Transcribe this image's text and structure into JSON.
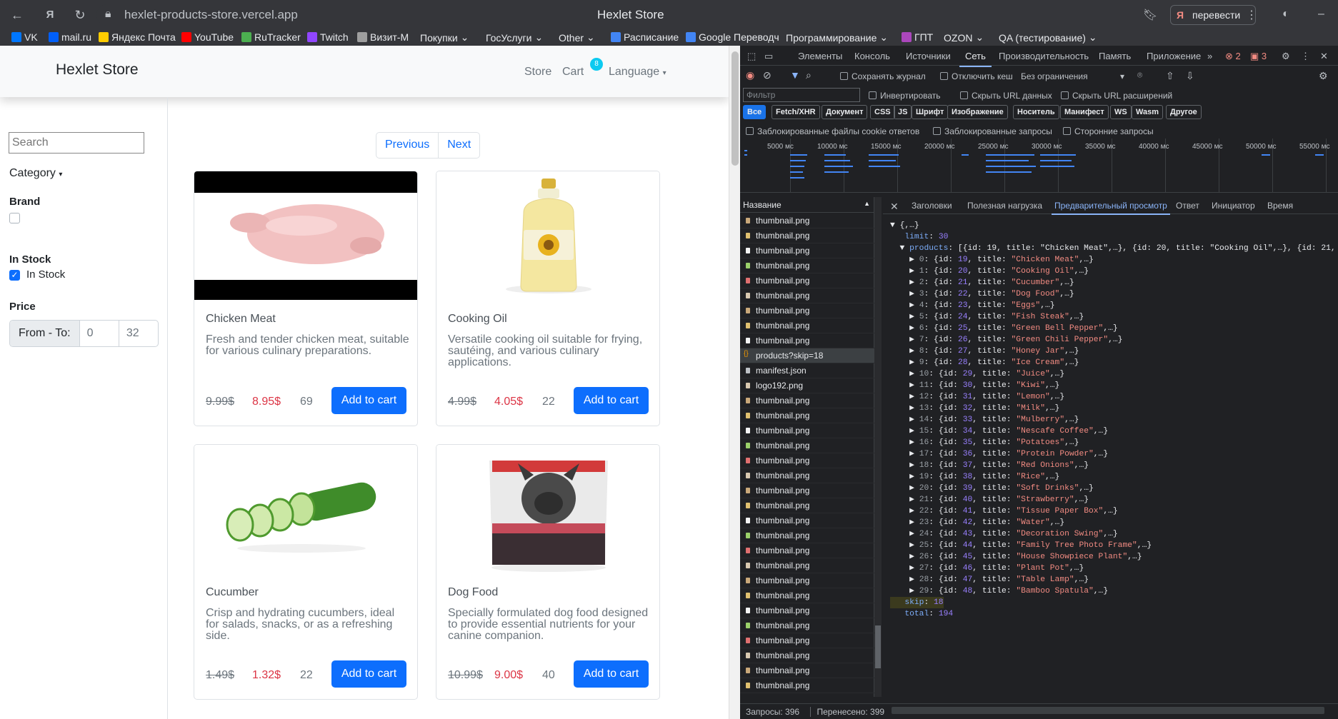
{
  "browser": {
    "url": "hexlet-products-store.vercel.app",
    "window_title": "Hexlet Store",
    "translate_label": "перевести"
  },
  "bookmarks": [
    {
      "label": "VK",
      "color": "#0077ff"
    },
    {
      "label": "mail.ru",
      "color": "#005ff9"
    },
    {
      "label": "Яндекс Почта",
      "color": "#ffcc00"
    },
    {
      "label": "YouTube",
      "color": "#ff0000"
    },
    {
      "label": "RuTracker",
      "color": "#4caf50"
    },
    {
      "label": "Twitch",
      "color": "#9146ff"
    },
    {
      "label": "Визит-М",
      "color": "#9e9e9e"
    },
    {
      "label": "Покупки",
      "color": "#fbbc04"
    },
    {
      "label": "ГосУслуги",
      "color": "#fbbc04"
    },
    {
      "label": "Other",
      "color": "#fbbc04"
    },
    {
      "label": "Расписание",
      "color": "#4285f4"
    },
    {
      "label": "Google Переводч",
      "color": "#4285f4"
    },
    {
      "label": "Программирование",
      "color": "#fbbc04"
    },
    {
      "label": "ГПТ",
      "color": "#ab47bc"
    },
    {
      "label": "OZON",
      "color": "#fbbc04"
    },
    {
      "label": "QA (тестирование)",
      "color": "#fbbc04"
    }
  ],
  "store": {
    "brand": "Hexlet Store",
    "nav_store": "Store",
    "nav_cart": "Cart",
    "cart_count": "8",
    "nav_language": "Language",
    "search_placeholder": "Search",
    "category_label": "Category",
    "brand_label": "Brand",
    "in_stock_heading": "In Stock",
    "in_stock_checkbox": "In Stock",
    "in_stock_checked": true,
    "price_label": "Price",
    "price_addon": "From - To:",
    "price_from": "0",
    "price_to": "32",
    "prev_label": "Previous",
    "next_label": "Next",
    "add_to_cart_label": "Add to cart",
    "products": [
      {
        "title": "Chicken Meat",
        "description": "Fresh and tender chicken meat, suitable for various culinary preparations.",
        "old_price": "9.99$",
        "price": "8.95$",
        "stock": "69"
      },
      {
        "title": "Cooking Oil",
        "description": "Versatile cooking oil suitable for frying, sautéing, and various culinary applications.",
        "old_price": "4.99$",
        "price": "4.05$",
        "stock": "22"
      },
      {
        "title": "Cucumber",
        "description": "Crisp and hydrating cucumbers, ideal for salads, snacks, or as a refreshing side.",
        "old_price": "1.49$",
        "price": "1.32$",
        "stock": "22"
      },
      {
        "title": "Dog Food",
        "description": "Specially formulated dog food designed to provide essential nutrients for your canine companion.",
        "old_price": "10.99$",
        "price": "9.00$",
        "stock": "40"
      }
    ]
  },
  "devtools": {
    "tabs": [
      "Элементы",
      "Консоль",
      "Источники",
      "Сеть",
      "Производительность",
      "Память",
      "Приложение"
    ],
    "active_tab": "Сеть",
    "errors": "2",
    "warnings": "3",
    "preserve_log": "Сохранять журнал",
    "disable_cache": "Отключить кеш",
    "throttle": "Без ограничения",
    "filter_placeholder": "Фильтр",
    "invert": "Инвертировать",
    "hide_data_urls": "Скрыть URL данных",
    "hide_ext_urls": "Скрыть URL расширений",
    "type_filters": [
      "Все",
      "Fetch/XHR",
      "Документ",
      "CSS",
      "JS",
      "Шрифт",
      "Изображение",
      "Носитель",
      "Манифест",
      "WS",
      "Wasm",
      "Другое"
    ],
    "blocked_cookies": "Заблокированные файлы cookie ответов",
    "blocked_requests": "Заблокированные запросы",
    "third_party": "Сторонние запросы",
    "timeline_labels": [
      "5000 мс",
      "10000 мс",
      "15000 мс",
      "20000 мс",
      "25000 мс",
      "30000 мс",
      "35000 мс",
      "40000 мс",
      "45000 мс",
      "50000 мс",
      "55000 мс"
    ],
    "name_header": "Название",
    "requests": [
      "thumbnail.png",
      "thumbnail.png",
      "thumbnail.png",
      "thumbnail.png",
      "thumbnail.png",
      "thumbnail.png",
      "thumbnail.png",
      "thumbnail.png",
      "thumbnail.png",
      "products?skip=18",
      "manifest.json",
      "logo192.png",
      "thumbnail.png",
      "thumbnail.png",
      "thumbnail.png",
      "thumbnail.png",
      "thumbnail.png",
      "thumbnail.png",
      "thumbnail.png",
      "thumbnail.png",
      "thumbnail.png",
      "thumbnail.png",
      "thumbnail.png",
      "thumbnail.png",
      "thumbnail.png",
      "thumbnail.png",
      "thumbnail.png",
      "thumbnail.png",
      "thumbnail.png",
      "thumbnail.png",
      "thumbnail.png",
      "thumbnail.png"
    ],
    "detail_tabs": [
      "Заголовки",
      "Полезная нагрузка",
      "Предварительный просмотр",
      "Ответ",
      "Инициатор",
      "Время"
    ],
    "active_detail_tab": "Предварительный просмотр",
    "json_root": "{,…}",
    "limit": "30",
    "products_summary": "[{id: 19, title: \"Chicken Meat\",…}, {id: 20, title: \"Cooking Oil\",…}, {id: 21, ti",
    "items": [
      {
        "i": "0",
        "id": "19",
        "title": "Chicken Meat"
      },
      {
        "i": "1",
        "id": "20",
        "title": "Cooking Oil"
      },
      {
        "i": "2",
        "id": "21",
        "title": "Cucumber"
      },
      {
        "i": "3",
        "id": "22",
        "title": "Dog Food"
      },
      {
        "i": "4",
        "id": "23",
        "title": "Eggs"
      },
      {
        "i": "5",
        "id": "24",
        "title": "Fish Steak"
      },
      {
        "i": "6",
        "id": "25",
        "title": "Green Bell Pepper"
      },
      {
        "i": "7",
        "id": "26",
        "title": "Green Chili Pepper"
      },
      {
        "i": "8",
        "id": "27",
        "title": "Honey Jar"
      },
      {
        "i": "9",
        "id": "28",
        "title": "Ice Cream"
      },
      {
        "i": "10",
        "id": "29",
        "title": "Juice"
      },
      {
        "i": "11",
        "id": "30",
        "title": "Kiwi"
      },
      {
        "i": "12",
        "id": "31",
        "title": "Lemon"
      },
      {
        "i": "13",
        "id": "32",
        "title": "Milk"
      },
      {
        "i": "14",
        "id": "33",
        "title": "Mulberry"
      },
      {
        "i": "15",
        "id": "34",
        "title": "Nescafe Coffee"
      },
      {
        "i": "16",
        "id": "35",
        "title": "Potatoes"
      },
      {
        "i": "17",
        "id": "36",
        "title": "Protein Powder"
      },
      {
        "i": "18",
        "id": "37",
        "title": "Red Onions"
      },
      {
        "i": "19",
        "id": "38",
        "title": "Rice"
      },
      {
        "i": "20",
        "id": "39",
        "title": "Soft Drinks"
      },
      {
        "i": "21",
        "id": "40",
        "title": "Strawberry"
      },
      {
        "i": "22",
        "id": "41",
        "title": "Tissue Paper Box"
      },
      {
        "i": "23",
        "id": "42",
        "title": "Water"
      },
      {
        "i": "24",
        "id": "43",
        "title": "Decoration Swing"
      },
      {
        "i": "25",
        "id": "44",
        "title": "Family Tree Photo Frame"
      },
      {
        "i": "26",
        "id": "45",
        "title": "House Showpiece Plant"
      },
      {
        "i": "27",
        "id": "46",
        "title": "Plant Pot"
      },
      {
        "i": "28",
        "id": "47",
        "title": "Table Lamp"
      },
      {
        "i": "29",
        "id": "48",
        "title": "Bamboo Spatula"
      }
    ],
    "skip": "18",
    "total": "194",
    "status_requests": "Запросы: 396",
    "status_transferred": "Перенесено: 399"
  }
}
